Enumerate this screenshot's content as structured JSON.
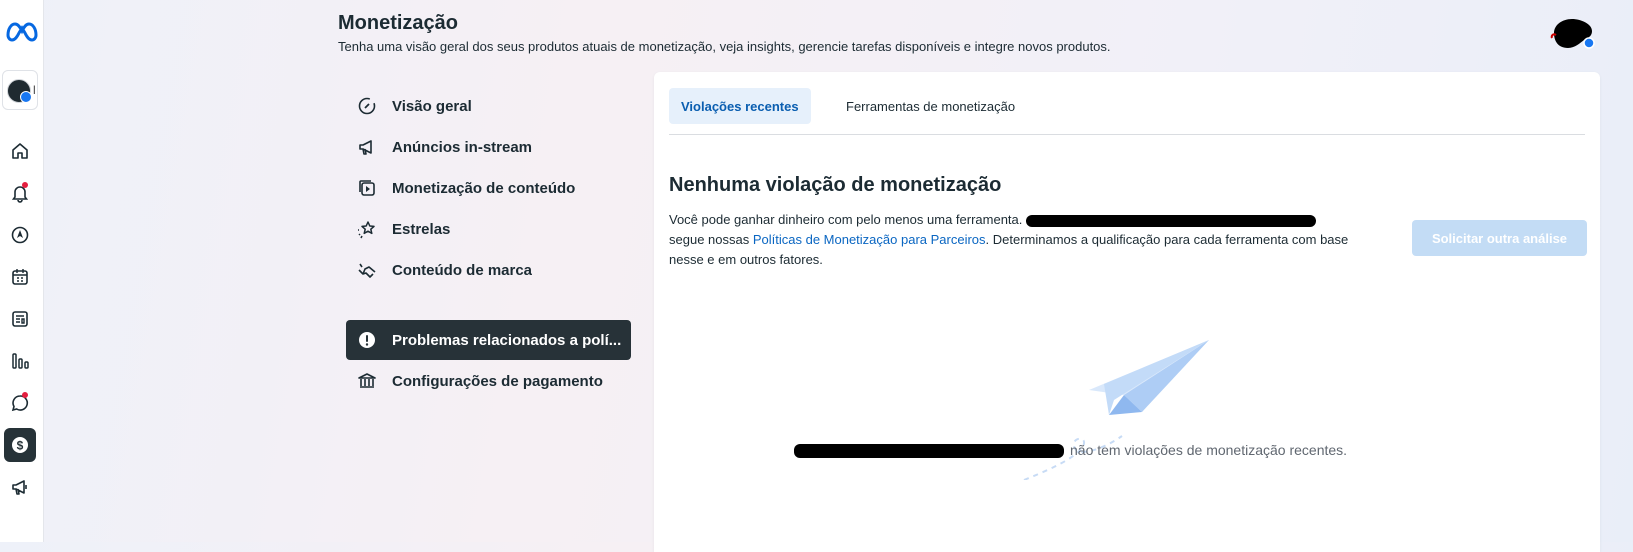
{
  "header": {
    "title": "Monetização",
    "subtitle": "Tenha uma visão geral dos seus produtos atuais de monetização, veja insights, gerencie tarefas disponíveis e integre novos produtos."
  },
  "rail": {
    "items": [
      {
        "icon": "home-icon"
      },
      {
        "icon": "bell-icon",
        "badge": true
      },
      {
        "icon": "compass-icon"
      },
      {
        "icon": "calendar-icon"
      },
      {
        "icon": "content-library-icon"
      },
      {
        "icon": "insights-bars-icon"
      },
      {
        "icon": "chat-bubble-icon",
        "badge": true
      },
      {
        "icon": "dollar-icon",
        "active": true
      },
      {
        "icon": "megaphone-icon"
      }
    ]
  },
  "nav": {
    "items": [
      {
        "label": "Visão geral",
        "icon": "overview-gauge-icon"
      },
      {
        "label": "Anúncios in-stream",
        "icon": "megaphone-icon"
      },
      {
        "label": "Monetização de conteúdo",
        "icon": "play-stack-icon"
      },
      {
        "label": "Estrelas",
        "icon": "stars-icon"
      },
      {
        "label": "Conteúdo de marca",
        "icon": "handshake-icon"
      },
      {
        "label": "Problemas relacionados a polí...",
        "icon": "alert-circle-icon",
        "active": true
      },
      {
        "label": "Configurações de pagamento",
        "icon": "bank-icon"
      }
    ]
  },
  "tabs": [
    {
      "label": "Violações recentes",
      "active": true
    },
    {
      "label": "Ferramentas de monetização"
    }
  ],
  "main": {
    "heading": "Nenhuma violação de monetização",
    "body_pre": "Você pode ganhar dinheiro com pelo menos uma ferramenta.",
    "body_mid": "segue nossas ",
    "body_link": "Políticas de Monetização para Parceiros",
    "body_post": ". Determinamos a qualificação para cada ferramenta com base nesse e em outros fatores.",
    "request_button": "Solicitar outra análise",
    "empty_message": "não tem violações de monetização recentes."
  },
  "colors": {
    "active_nav_bg": "#273238",
    "link": "#0a66c2",
    "tab_active_bg": "#e6f0fb",
    "badge": "#e41e3f"
  }
}
